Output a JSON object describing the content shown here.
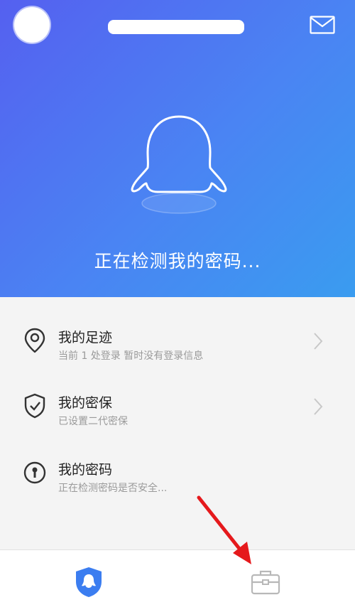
{
  "header": {
    "avatar_icon": "user-avatar",
    "mail_icon": "mail-icon"
  },
  "hero": {
    "status_text": "正在检测我的密码..."
  },
  "menu": {
    "items": [
      {
        "icon": "location-pin-icon",
        "title": "我的足迹",
        "subtitle": "当前 1 处登录 暂时没有登录信息",
        "has_chevron": true
      },
      {
        "icon": "shield-check-icon",
        "title": "我的密保",
        "subtitle": "已设置二代密保",
        "has_chevron": true
      },
      {
        "icon": "keyhole-icon",
        "title": "我的密码",
        "subtitle": "正在检测密码是否安全...",
        "has_chevron": false
      }
    ]
  },
  "tabbar": {
    "tabs": [
      {
        "icon": "qq-shield-icon",
        "active": true
      },
      {
        "icon": "toolbox-icon",
        "active": false
      }
    ]
  },
  "colors": {
    "hero_start": "#5560f0",
    "hero_end": "#3a9cf0",
    "accent": "#3b7df0",
    "annotation_arrow": "#e5191c"
  }
}
